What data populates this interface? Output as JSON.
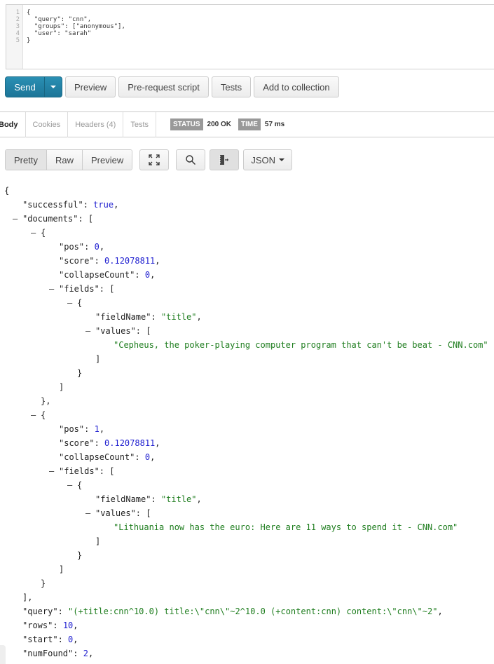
{
  "request_body": {
    "line_numbers": [
      "1",
      "2",
      "3",
      "4",
      "5"
    ],
    "lines": [
      "{",
      "  \"query\": \"cnn\",",
      "  \"groups\": [\"anonymous\"],",
      "  \"user\": \"sarah\"",
      "}"
    ]
  },
  "toolbar": {
    "send_label": "Send",
    "send_menu_icon": "caret-down-icon",
    "preview_label": "Preview",
    "prerequest_label": "Pre-request script",
    "tests_label": "Tests",
    "add_collection_label": "Add to collection"
  },
  "response_tabs": {
    "tabs": [
      "Body",
      "Cookies",
      "Headers (4)",
      "Tests"
    ],
    "active": "Body",
    "status_label": "STATUS",
    "status_value": "200 OK",
    "time_label": "TIME",
    "time_value": "57 ms"
  },
  "view_toolbar": {
    "modes": [
      "Pretty",
      "Raw",
      "Preview"
    ],
    "active_mode": "Pretty",
    "expand_icon": "expand-icon",
    "search_icon": "search-icon",
    "wrap_icon": "wrap-lines-icon",
    "format_label": "JSON"
  },
  "response_lines": [
    {
      "indent": 0,
      "parts": [
        [
          "p",
          "{"
        ]
      ]
    },
    {
      "indent": 1,
      "parts": [
        [
          "k",
          "\"successful\""
        ],
        [
          "p",
          ": "
        ],
        [
          "b",
          "true"
        ],
        [
          "p",
          ","
        ]
      ]
    },
    {
      "indent": 1,
      "collapse": true,
      "parts": [
        [
          "k",
          "\"documents\""
        ],
        [
          "p",
          ": ["
        ]
      ]
    },
    {
      "indent": 2,
      "collapse": true,
      "parts": [
        [
          "p",
          "{"
        ]
      ]
    },
    {
      "indent": 3,
      "parts": [
        [
          "k",
          "\"pos\""
        ],
        [
          "p",
          ": "
        ],
        [
          "n",
          "0"
        ],
        [
          "p",
          ","
        ]
      ]
    },
    {
      "indent": 3,
      "parts": [
        [
          "k",
          "\"score\""
        ],
        [
          "p",
          ": "
        ],
        [
          "n",
          "0.12078811"
        ],
        [
          "p",
          ","
        ]
      ]
    },
    {
      "indent": 3,
      "parts": [
        [
          "k",
          "\"collapseCount\""
        ],
        [
          "p",
          ": "
        ],
        [
          "n",
          "0"
        ],
        [
          "p",
          ","
        ]
      ]
    },
    {
      "indent": 3,
      "collapse": true,
      "parts": [
        [
          "k",
          "\"fields\""
        ],
        [
          "p",
          ": ["
        ]
      ]
    },
    {
      "indent": 4,
      "collapse": true,
      "parts": [
        [
          "p",
          "{"
        ]
      ]
    },
    {
      "indent": 5,
      "parts": [
        [
          "k",
          "\"fieldName\""
        ],
        [
          "p",
          ": "
        ],
        [
          "s",
          "\"title\""
        ],
        [
          "p",
          ","
        ]
      ]
    },
    {
      "indent": 5,
      "collapse": true,
      "parts": [
        [
          "k",
          "\"values\""
        ],
        [
          "p",
          ": ["
        ]
      ]
    },
    {
      "indent": 6,
      "parts": [
        [
          "s",
          "\"Cepheus, the poker-playing computer program that can't be beat - CNN.com\""
        ]
      ]
    },
    {
      "indent": 5,
      "parts": [
        [
          "p",
          "]"
        ]
      ]
    },
    {
      "indent": 4,
      "parts": [
        [
          "p",
          "}"
        ]
      ]
    },
    {
      "indent": 3,
      "parts": [
        [
          "p",
          "]"
        ]
      ]
    },
    {
      "indent": 2,
      "parts": [
        [
          "p",
          "},"
        ]
      ]
    },
    {
      "indent": 2,
      "collapse": true,
      "parts": [
        [
          "p",
          "{"
        ]
      ]
    },
    {
      "indent": 3,
      "parts": [
        [
          "k",
          "\"pos\""
        ],
        [
          "p",
          ": "
        ],
        [
          "n",
          "1"
        ],
        [
          "p",
          ","
        ]
      ]
    },
    {
      "indent": 3,
      "parts": [
        [
          "k",
          "\"score\""
        ],
        [
          "p",
          ": "
        ],
        [
          "n",
          "0.12078811"
        ],
        [
          "p",
          ","
        ]
      ]
    },
    {
      "indent": 3,
      "parts": [
        [
          "k",
          "\"collapseCount\""
        ],
        [
          "p",
          ": "
        ],
        [
          "n",
          "0"
        ],
        [
          "p",
          ","
        ]
      ]
    },
    {
      "indent": 3,
      "collapse": true,
      "parts": [
        [
          "k",
          "\"fields\""
        ],
        [
          "p",
          ": ["
        ]
      ]
    },
    {
      "indent": 4,
      "collapse": true,
      "parts": [
        [
          "p",
          "{"
        ]
      ]
    },
    {
      "indent": 5,
      "parts": [
        [
          "k",
          "\"fieldName\""
        ],
        [
          "p",
          ": "
        ],
        [
          "s",
          "\"title\""
        ],
        [
          "p",
          ","
        ]
      ]
    },
    {
      "indent": 5,
      "collapse": true,
      "parts": [
        [
          "k",
          "\"values\""
        ],
        [
          "p",
          ": ["
        ]
      ]
    },
    {
      "indent": 6,
      "parts": [
        [
          "s",
          "\"Lithuania now has the euro: Here are 11 ways to spend it - CNN.com\""
        ]
      ]
    },
    {
      "indent": 5,
      "parts": [
        [
          "p",
          "]"
        ]
      ]
    },
    {
      "indent": 4,
      "parts": [
        [
          "p",
          "}"
        ]
      ]
    },
    {
      "indent": 3,
      "parts": [
        [
          "p",
          "]"
        ]
      ]
    },
    {
      "indent": 2,
      "parts": [
        [
          "p",
          "}"
        ]
      ]
    },
    {
      "indent": 1,
      "parts": [
        [
          "p",
          "],"
        ]
      ]
    },
    {
      "indent": 1,
      "parts": [
        [
          "k",
          "\"query\""
        ],
        [
          "p",
          ": "
        ],
        [
          "s",
          "\"(+title:cnn^10.0) title:\\\"cnn\\\"~2^10.0 (+content:cnn) content:\\\"cnn\\\"~2\""
        ],
        [
          "p",
          ","
        ]
      ]
    },
    {
      "indent": 1,
      "parts": [
        [
          "k",
          "\"rows\""
        ],
        [
          "p",
          ": "
        ],
        [
          "n",
          "10"
        ],
        [
          "p",
          ","
        ]
      ]
    },
    {
      "indent": 1,
      "parts": [
        [
          "k",
          "\"start\""
        ],
        [
          "p",
          ": "
        ],
        [
          "n",
          "0"
        ],
        [
          "p",
          ","
        ]
      ]
    },
    {
      "indent": 1,
      "parts": [
        [
          "k",
          "\"numFound\""
        ],
        [
          "p",
          ": "
        ],
        [
          "n",
          "2"
        ],
        [
          "p",
          ","
        ]
      ]
    }
  ]
}
